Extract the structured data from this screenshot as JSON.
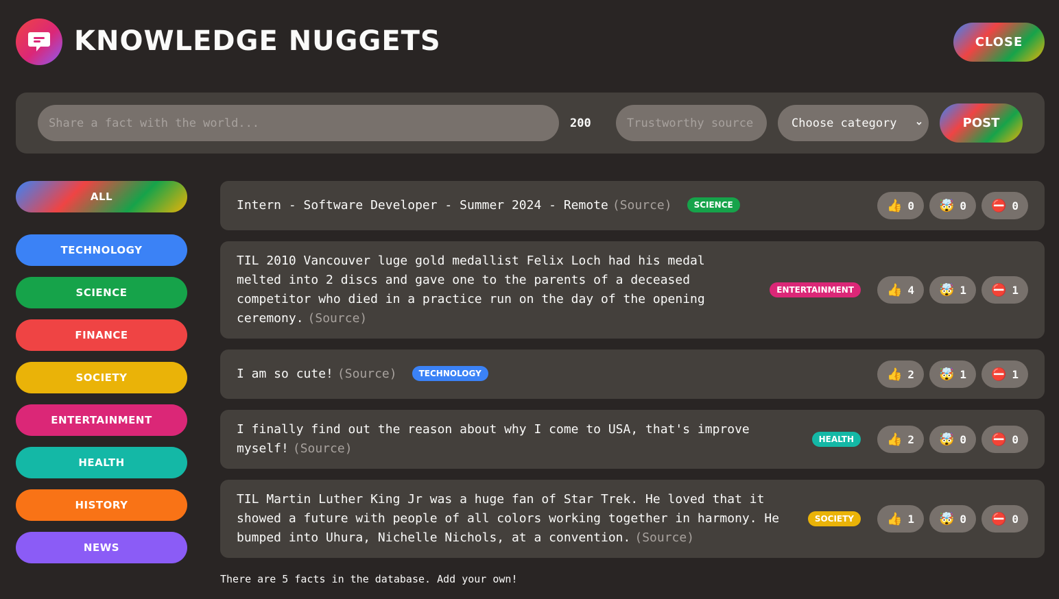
{
  "header": {
    "title": "KNOWLEDGE NUGGETS",
    "close_label": "CLOSE",
    "logo_icon": "chat-bubble-icon"
  },
  "form": {
    "fact_placeholder": "Share a fact with the world...",
    "fact_value": "",
    "char_count": "200",
    "source_placeholder": "Trustworthy source...",
    "category_selected": "Choose category",
    "post_label": "POST"
  },
  "categories": [
    {
      "label": "ALL",
      "color": "gradient"
    },
    {
      "label": "TECHNOLOGY",
      "color": "#3b82f6"
    },
    {
      "label": "SCIENCE",
      "color": "#16a34a"
    },
    {
      "label": "FINANCE",
      "color": "#ef4444"
    },
    {
      "label": "SOCIETY",
      "color": "#eab308"
    },
    {
      "label": "ENTERTAINMENT",
      "color": "#db2777"
    },
    {
      "label": "HEALTH",
      "color": "#14b8a6"
    },
    {
      "label": "HISTORY",
      "color": "#f97316"
    },
    {
      "label": "NEWS",
      "color": "#8b5cf6"
    }
  ],
  "facts": [
    {
      "text": "Intern - Software Developer - Summer 2024 - Remote",
      "source": "(Source)",
      "category": "SCIENCE",
      "color": "#16a34a",
      "likes": "0",
      "mindblown": "0",
      "false": "0"
    },
    {
      "text": "TIL 2010 Vancouver luge gold medallist Felix Loch had his medal melted into 2 discs and gave one to the parents of a deceased competitor who died in a practice run on the day of the opening ceremony.",
      "source": "(Source)",
      "category": "ENTERTAINMENT",
      "color": "#db2777",
      "likes": "4",
      "mindblown": "1",
      "false": "1"
    },
    {
      "text": "I am so cute!",
      "source": "(Source)",
      "category": "TECHNOLOGY",
      "color": "#3b82f6",
      "likes": "2",
      "mindblown": "1",
      "false": "1"
    },
    {
      "text": "I finally find out the reason about why I come to USA, that's improve myself!",
      "source": "(Source)",
      "category": "HEALTH",
      "color": "#14b8a6",
      "likes": "2",
      "mindblown": "0",
      "false": "0"
    },
    {
      "text": "TIL Martin Luther King Jr was a huge fan of Star Trek. He loved that it showed a future with people of all colors working together in harmony. He bumped into Uhura, Nichelle Nichols, at a convention.",
      "source": "(Source)",
      "category": "SOCIETY",
      "color": "#eab308",
      "likes": "1",
      "mindblown": "0",
      "false": "0"
    }
  ],
  "vote_icons": {
    "like": "👍",
    "mindblown": "🤯",
    "false": "⛔"
  },
  "footer": "There are 5 facts in the database. Add your own!"
}
